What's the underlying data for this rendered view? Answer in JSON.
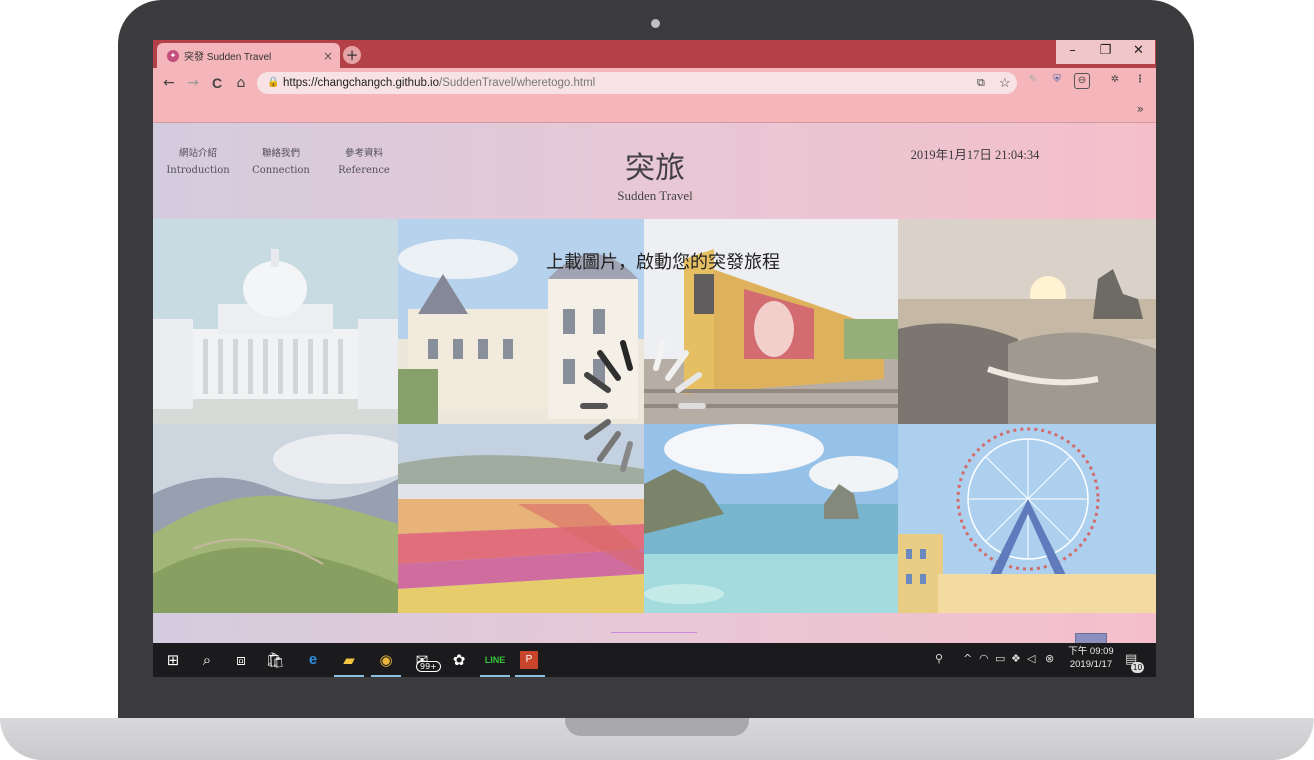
{
  "browser": {
    "tab_title": "突發 Sudden Travel",
    "tab_close": "×",
    "new_tab": "+",
    "url_host": "https://changchangch.github.io",
    "url_path": "/SuddenTravel/wheretogo.html",
    "back": "←",
    "forward": "→",
    "reload": "C",
    "home": "⌂",
    "bookmark_star": "☆",
    "more_menu": "⋮",
    "bookmarks_more": "»",
    "window": {
      "minimize": "–",
      "maximize": "❐",
      "close": "✕"
    }
  },
  "site": {
    "nav": [
      {
        "zh": "網站介紹",
        "en": "Introduction"
      },
      {
        "zh": "聯絡我們",
        "en": "Connection"
      },
      {
        "zh": "參考資料",
        "en": "Reference"
      }
    ],
    "title": "突旅",
    "subtitle": "Sudden Travel",
    "datetime": "2019年1月17日 21:04:34",
    "upload_prompt": "上載圖片，啟動您的突發旅程"
  },
  "taskbar": {
    "mail_badge": "99+",
    "time": "下午 09:09",
    "date": "2019/1/17",
    "notification_count": "10"
  },
  "colors": {
    "tabbar": "#b34147",
    "toolbar": "#f4b6bb",
    "taskbar": "#1b1b1d"
  }
}
